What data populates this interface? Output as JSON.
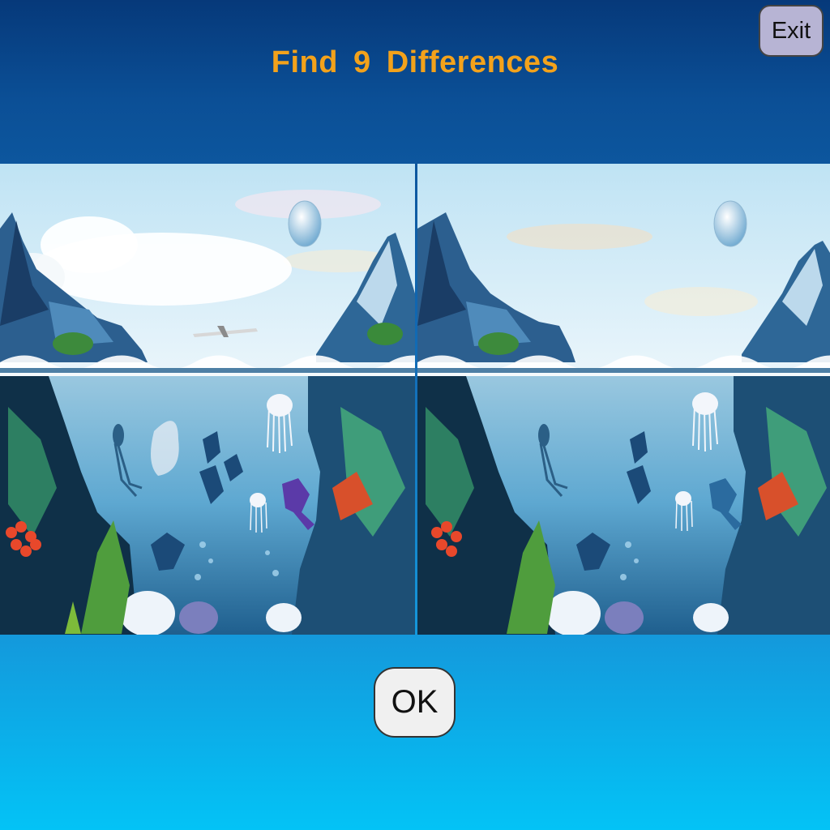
{
  "game": {
    "title": "Find 9 Differences",
    "exit_label": "Exit",
    "ok_label": "OK"
  },
  "colors": {
    "title": "#f3a21b",
    "exit_button_bg": "#b7b4d4",
    "ok_button_bg": "#f0f0f0"
  },
  "scene": {
    "left": {
      "has_cloud": true,
      "has_airplane": true,
      "has_purple_fish": true,
      "has_white_fish": true,
      "small_fish_count": 4,
      "has_lower_fish": true
    },
    "right": {
      "has_cloud": false,
      "has_airplane": false,
      "has_purple_fish": false,
      "has_white_fish": false,
      "small_fish_count": 3,
      "has_lower_fish": true
    }
  }
}
